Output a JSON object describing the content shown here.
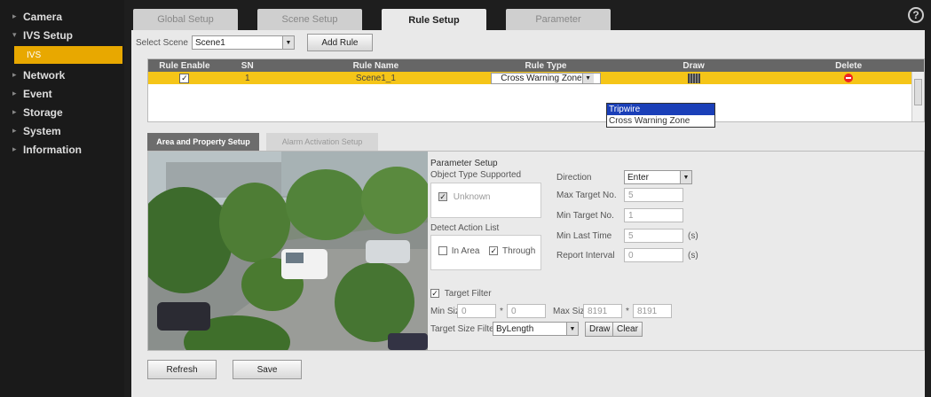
{
  "sidebar": {
    "items": [
      {
        "label": "Camera",
        "marker": "▸"
      },
      {
        "label": "IVS Setup",
        "marker": "▾"
      },
      {
        "label": "Network",
        "marker": "▸"
      },
      {
        "label": "Event",
        "marker": "▸"
      },
      {
        "label": "Storage",
        "marker": "▸"
      },
      {
        "label": "System",
        "marker": "▸"
      },
      {
        "label": "Information",
        "marker": "▸"
      }
    ],
    "sub_item": "IVS"
  },
  "tabs": [
    "Global Setup",
    "Scene Setup",
    "Rule Setup",
    "Parameter"
  ],
  "help_icon": "?",
  "scene": {
    "label": "Select Scene",
    "value": "Scene1",
    "add_rule": "Add Rule"
  },
  "rule_table": {
    "headers": [
      "Rule Enable",
      "SN",
      "Rule Name",
      "Rule Type",
      "Draw",
      "Delete"
    ],
    "row": {
      "enable": "✓",
      "sn": "1",
      "name": "Scene1_1",
      "type": "Cross Warning Zone"
    },
    "type_options": [
      "Tripwire",
      "Cross Warning Zone"
    ]
  },
  "sub_tabs": [
    "Area and Property Setup",
    "Alarm Activation Setup"
  ],
  "params": {
    "title": "Parameter Setup",
    "object_type_label": "Object Type Supported",
    "object_type_value": "Unknown",
    "detect_action_label": "Detect Action List",
    "in_area": "In Area",
    "through": "Through",
    "direction_label": "Direction",
    "direction_value": "Enter",
    "max_target_label": "Max Target No.",
    "max_target_value": "5",
    "min_target_label": "Min Target No.",
    "min_target_value": "1",
    "min_last_label": "Min Last Time",
    "min_last_value": "5",
    "report_label": "Report Interval",
    "report_value": "0",
    "unit_s": "(s)",
    "target_filter": "Target Filter",
    "min_size_label": "Min Size",
    "min_size_w": "0",
    "min_size_h": "0",
    "max_size_label": "Max Size",
    "max_size_w": "8191",
    "max_size_h": "8191",
    "size_sep": "*",
    "size_filter_label": "Target Size Filter",
    "size_filter_value": "ByLength",
    "draw_btn": "Draw",
    "clear_btn": "Clear"
  },
  "bottom": {
    "refresh": "Refresh",
    "save": "Save"
  }
}
